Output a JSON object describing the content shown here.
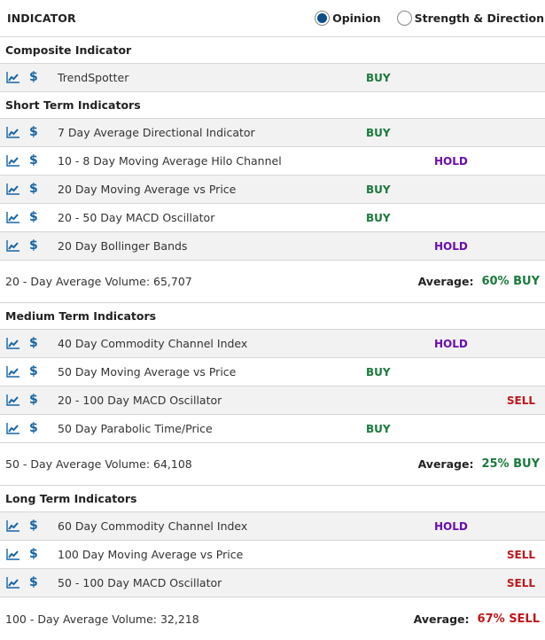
{
  "header": {
    "title": "INDICATOR",
    "view_options": [
      {
        "label": "Opinion",
        "selected": true
      },
      {
        "label": "Strength & Direction",
        "selected": false
      }
    ]
  },
  "colors": {
    "buy": "#1a7a3c",
    "hold": "#6a0dad",
    "sell": "#c0151b",
    "icon_blue": "#1565a7",
    "radio_selected": "#0b4f8a"
  },
  "icons": {
    "chart": "line-chart-icon",
    "price": "dollar-icon"
  },
  "sections": [
    {
      "title": "Composite Indicator",
      "rows": [
        {
          "name": "TrendSpotter",
          "signal": "BUY"
        }
      ]
    },
    {
      "title": "Short Term Indicators",
      "rows": [
        {
          "name": "7 Day Average Directional Indicator",
          "signal": "BUY"
        },
        {
          "name": "10 - 8 Day Moving Average Hilo Channel",
          "signal": "HOLD"
        },
        {
          "name": "20 Day Moving Average vs Price",
          "signal": "BUY"
        },
        {
          "name": "20 - 50 Day MACD Oscillator",
          "signal": "BUY"
        },
        {
          "name": "20 Day Bollinger Bands",
          "signal": "HOLD"
        }
      ],
      "summary": {
        "volume": "20 - Day Average Volume: 65,707",
        "average_label": "Average:",
        "average_value": "60% BUY",
        "average_signal": "BUY"
      }
    },
    {
      "title": "Medium Term Indicators",
      "rows": [
        {
          "name": "40 Day Commodity Channel Index",
          "signal": "HOLD"
        },
        {
          "name": "50 Day Moving Average vs Price",
          "signal": "BUY"
        },
        {
          "name": "20 - 100 Day MACD Oscillator",
          "signal": "SELL"
        },
        {
          "name": "50 Day Parabolic Time/Price",
          "signal": "BUY"
        }
      ],
      "summary": {
        "volume": "50 - Day Average Volume: 64,108",
        "average_label": "Average:",
        "average_value": "25% BUY",
        "average_signal": "BUY"
      }
    },
    {
      "title": "Long Term Indicators",
      "rows": [
        {
          "name": "60 Day Commodity Channel Index",
          "signal": "HOLD"
        },
        {
          "name": "100 Day Moving Average vs Price",
          "signal": "SELL"
        },
        {
          "name": "50 - 100 Day MACD Oscillator",
          "signal": "SELL"
        }
      ],
      "summary": {
        "volume": "100 - Day Average Volume: 32,218",
        "average_label": "Average:",
        "average_value": "67% SELL",
        "average_signal": "SELL"
      }
    }
  ]
}
